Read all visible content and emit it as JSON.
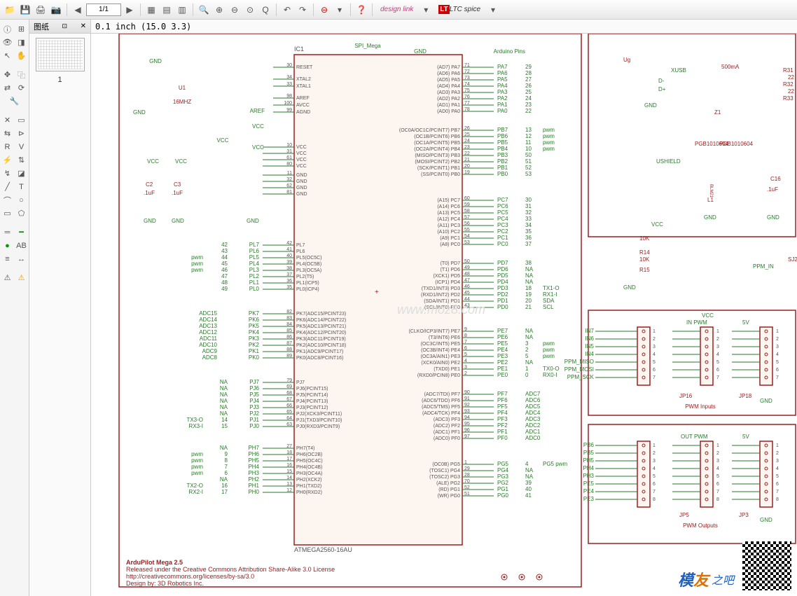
{
  "toolbar": {
    "page_input": "1/1",
    "design_link": "design link",
    "ltc_spice": "LTC spice"
  },
  "thumb": {
    "title": "图纸",
    "page_num": "1"
  },
  "coord": "0.1  inch  (15.0  3.3)",
  "chip": {
    "ref": "IC1",
    "name": "ATMEGA2560-16AU",
    "header_net": "SPI_Mega",
    "header_gnd": "GND",
    "arduino_pins": "Arduino Pins",
    "left_top": [
      {
        "num": "30",
        "name": "RESET"
      },
      {
        "num": "34",
        "name": "XTAL2"
      },
      {
        "num": "33",
        "name": "XTAL1"
      },
      {
        "num": "98",
        "name": "AREF"
      },
      {
        "num": "100",
        "name": "AVCC"
      },
      {
        "num": "99",
        "name": "AGND"
      }
    ],
    "vcc_pins": [
      {
        "num": "10",
        "name": "VCC"
      },
      {
        "num": "31",
        "name": "VCC"
      },
      {
        "num": "61",
        "name": "VCC"
      },
      {
        "num": "80",
        "name": "VCC"
      }
    ],
    "gnd_pins": [
      {
        "num": "11",
        "name": "GND"
      },
      {
        "num": "32",
        "name": "GND"
      },
      {
        "num": "62",
        "name": "GND"
      },
      {
        "num": "81",
        "name": "GND"
      }
    ],
    "pl": [
      {
        "ard": "42",
        "net": "PL7",
        "num": "42",
        "name": "PL7"
      },
      {
        "ard": "43",
        "net": "PL6",
        "num": "41",
        "name": "PL6"
      },
      {
        "ard": "44",
        "net": "PL5",
        "num": "40",
        "name": "PL5(OC5C)",
        "suf": "pwm"
      },
      {
        "ard": "45",
        "net": "PL4",
        "num": "39",
        "name": "PL4(OC5B)",
        "suf": "pwm"
      },
      {
        "ard": "46",
        "net": "PL3",
        "num": "38",
        "name": "PL3(OC5A)",
        "suf": "pwm"
      },
      {
        "ard": "47",
        "net": "PL2",
        "num": "37",
        "name": "PL2(T5)"
      },
      {
        "ard": "48",
        "net": "PL1",
        "num": "36",
        "name": "PL1(ICP5)"
      },
      {
        "ard": "49",
        "net": "PL0",
        "num": "35",
        "name": "PL0(ICP4)"
      }
    ],
    "pk": [
      {
        "net": "PK7",
        "num": "82",
        "name": "PK7(ADC15/PCINT23)",
        "adc": "ADC15"
      },
      {
        "net": "PK6",
        "num": "83",
        "name": "PK6(ADC14/PCINT22)",
        "adc": "ADC14"
      },
      {
        "net": "PK5",
        "num": "84",
        "name": "PK5(ADC13/PCINT21)",
        "adc": "ADC13"
      },
      {
        "net": "PK4",
        "num": "85",
        "name": "PK4(ADC12/PCINT20)",
        "adc": "ADC12"
      },
      {
        "net": "PK3",
        "num": "86",
        "name": "PK3(ADC11/PCINT19)",
        "adc": "ADC11"
      },
      {
        "net": "PK2",
        "num": "87",
        "name": "PK2(ADC10/PCINT18)",
        "adc": "ADC10"
      },
      {
        "net": "PK1",
        "num": "88",
        "name": "PK1(ADC9/PCINT17)",
        "adc": "ADC9"
      },
      {
        "net": "PK0",
        "num": "89",
        "name": "PK0(ADC8/PCINT16)",
        "adc": "ADC8"
      }
    ],
    "pj": [
      {
        "net": "PJ7",
        "num": "79",
        "name": "PJ7",
        "ard": "NA"
      },
      {
        "net": "PJ6",
        "num": "69",
        "name": "PJ6(PCINT15)",
        "ard": "NA"
      },
      {
        "net": "PJ5",
        "num": "68",
        "name": "PJ5(PCINT14)",
        "ard": "NA"
      },
      {
        "net": "PJ4",
        "num": "67",
        "name": "PJ4(PCINT13)",
        "ard": "NA"
      },
      {
        "net": "PJ3",
        "num": "66",
        "name": "PJ3(PCINT12)",
        "ard": "NA"
      },
      {
        "net": "PJ2",
        "num": "65",
        "name": "PJ2(XCK3/PCINT11)",
        "ard": "NA"
      },
      {
        "net": "PJ1",
        "num": "64",
        "name": "PJ1(TXD3/PCINT10)",
        "ard": "14",
        "suf": "TX3-O"
      },
      {
        "net": "PJ0",
        "num": "63",
        "name": "PJ0(RXD3/PCINT9)",
        "ard": "15",
        "suf": "RX3-I"
      }
    ],
    "ph": [
      {
        "net": "PH7",
        "num": "27",
        "name": "PH7(T4)",
        "ard": "NA"
      },
      {
        "net": "PH6",
        "num": "18",
        "name": "PH6(OC2B)",
        "ard": "9",
        "suf": "pwm"
      },
      {
        "net": "PH5",
        "num": "17",
        "name": "PH5(OC4C)",
        "ard": "8",
        "suf": "pwm"
      },
      {
        "net": "PH4",
        "num": "16",
        "name": "PH4(OC4B)",
        "ard": "7",
        "suf": "pwm"
      },
      {
        "net": "PH3",
        "num": "15",
        "name": "PH3(OC4A)",
        "ard": "6",
        "suf": "pwm"
      },
      {
        "net": "PH2",
        "num": "14",
        "name": "PH2(XCK2)",
        "ard": "NA"
      },
      {
        "net": "PH1",
        "num": "13",
        "name": "PH1(TXD2)",
        "ard": "16",
        "suf": "TX2-O"
      },
      {
        "net": "PH0",
        "num": "12",
        "name": "PH0(RXD2)",
        "ard": "17",
        "suf": "RX2-I"
      }
    ],
    "pa": [
      {
        "name": "(AD7) PA7",
        "num": "71",
        "net": "PA7",
        "ard": "29"
      },
      {
        "name": "(AD6) PA6",
        "num": "72",
        "net": "PA6",
        "ard": "28"
      },
      {
        "name": "(AD5) PA5",
        "num": "73",
        "net": "PA5",
        "ard": "27"
      },
      {
        "name": "(AD4) PA4",
        "num": "74",
        "net": "PA4",
        "ard": "26"
      },
      {
        "name": "(AD3) PA3",
        "num": "75",
        "net": "PA3",
        "ard": "25"
      },
      {
        "name": "(AD2) PA2",
        "num": "76",
        "net": "PA2",
        "ard": "24"
      },
      {
        "name": "(AD1) PA1",
        "num": "77",
        "net": "PA1",
        "ard": "23"
      },
      {
        "name": "(AD0) PA0",
        "num": "78",
        "net": "PA0",
        "ard": "22"
      }
    ],
    "pb": [
      {
        "name": "(OC0A/OC1C/PCINT7) PB7",
        "num": "26",
        "net": "PB7",
        "ard": "13",
        "suf": "pwm"
      },
      {
        "name": "(OC1B/PCINT6) PB6",
        "num": "25",
        "net": "PB6",
        "ard": "12",
        "suf": "pwm"
      },
      {
        "name": "(OC1A/PCINT5) PB5",
        "num": "24",
        "net": "PB5",
        "ard": "11",
        "suf": "pwm"
      },
      {
        "name": "(OC2A/PCINT4) PB4",
        "num": "23",
        "net": "PB4",
        "ard": "10",
        "suf": "pwm"
      },
      {
        "name": "(MISO/PCINT3) PB3",
        "num": "22",
        "net": "PB3",
        "ard": "50"
      },
      {
        "name": "(MOSI/PCINT2) PB2",
        "num": "21",
        "net": "PB2",
        "ard": "51"
      },
      {
        "name": "(SCK/PCINT1) PB1",
        "num": "20",
        "net": "PB1",
        "ard": "52"
      },
      {
        "name": "(SS/PCINT0) PB0",
        "num": "19",
        "net": "PB0",
        "ard": "53"
      }
    ],
    "pc": [
      {
        "name": "(A15) PC7",
        "num": "60",
        "net": "PC7",
        "ard": "30"
      },
      {
        "name": "(A14) PC6",
        "num": "59",
        "net": "PC6",
        "ard": "31"
      },
      {
        "name": "(A13) PC5",
        "num": "58",
        "net": "PC5",
        "ard": "32"
      },
      {
        "name": "(A12) PC4",
        "num": "57",
        "net": "PC4",
        "ard": "33"
      },
      {
        "name": "(A11) PC3",
        "num": "56",
        "net": "PC3",
        "ard": "34"
      },
      {
        "name": "(A10) PC2",
        "num": "55",
        "net": "PC2",
        "ard": "35"
      },
      {
        "name": "(A9) PC1",
        "num": "54",
        "net": "PC1",
        "ard": "36"
      },
      {
        "name": "(A8) PC0",
        "num": "53",
        "net": "PC0",
        "ard": "37"
      }
    ],
    "pd": [
      {
        "name": "(T0) PD7",
        "num": "50",
        "net": "PD7",
        "ard": "38"
      },
      {
        "name": "(T1) PD6",
        "num": "49",
        "net": "PD6",
        "ard": "NA"
      },
      {
        "name": "(XCK1) PD5",
        "num": "48",
        "net": "PD5",
        "ard": "NA"
      },
      {
        "name": "(ICP1) PD4",
        "num": "47",
        "net": "PD4",
        "ard": "NA"
      },
      {
        "name": "(TXD1/INT3) PD3",
        "num": "46",
        "net": "PD3",
        "ard": "18",
        "suf": "TX1-O"
      },
      {
        "name": "(RXD1/INT2) PD2",
        "num": "45",
        "net": "PD2",
        "ard": "19",
        "suf": "RX1-I"
      },
      {
        "name": "(SDA/INT1) PD1",
        "num": "44",
        "net": "PD1",
        "ard": "20",
        "suf": "SDA"
      },
      {
        "name": "(SCL/INT0) PD0",
        "num": "43",
        "net": "PD0",
        "ard": "21",
        "suf": "SCL"
      }
    ],
    "pe": [
      {
        "name": "(CLKO/ICP3/INT7) PE7",
        "num": "9",
        "net": "PE7",
        "ard": "NA"
      },
      {
        "name": "(T3/INT6) PE6",
        "num": "8",
        "net": "PE6",
        "ard": "NA"
      },
      {
        "name": "(OC3C/INT5) PE5",
        "num": "7",
        "net": "PE5",
        "ard": "3",
        "suf": "pwm"
      },
      {
        "name": "(OC3B/INT4) PE4",
        "num": "6",
        "net": "PE4",
        "ard": "2",
        "suf": "pwm"
      },
      {
        "name": "(OC3A/AIN1) PE3",
        "num": "5",
        "net": "PE3",
        "ard": "5",
        "suf": "pwm"
      },
      {
        "name": "(XCK0/AIN0) PE2",
        "num": "4",
        "net": "PE2",
        "ard": "NA"
      },
      {
        "name": "(TXD0) PE1",
        "num": "3",
        "net": "PE1",
        "ard": "1",
        "suf": "TX0-O"
      },
      {
        "name": "(RXD0/PCIN8) PE0",
        "num": "2",
        "net": "PE0",
        "ard": "0",
        "suf": "RX0-I"
      }
    ],
    "pf": [
      {
        "name": "(ADC7/TDI) PF7",
        "num": "90",
        "net": "PF7",
        "ard": "ADC7"
      },
      {
        "name": "(ADC6/TDO) PF6",
        "num": "91",
        "net": "PF6",
        "ard": "ADC6"
      },
      {
        "name": "(ADC5/TMS) PF5",
        "num": "92",
        "net": "PF5",
        "ard": "ADC5"
      },
      {
        "name": "(ADC4/TCK) PF4",
        "num": "93",
        "net": "PF4",
        "ard": "ADC4"
      },
      {
        "name": "(ADC3) PF3",
        "num": "94",
        "net": "PF3",
        "ard": "ADC3"
      },
      {
        "name": "(ADC2) PF2",
        "num": "95",
        "net": "PF2",
        "ard": "ADC2"
      },
      {
        "name": "(ADC1) PF1",
        "num": "96",
        "net": "PF1",
        "ard": "ADC1"
      },
      {
        "name": "(ADC0) PF0",
        "num": "97",
        "net": "PF0",
        "ard": "ADC0"
      }
    ],
    "pg": [
      {
        "name": "(OC0B) PG5",
        "num": "1",
        "net": "PG5",
        "ard": "4",
        "suf": "PG5 pwm"
      },
      {
        "name": "(TOSC1) PG4",
        "num": "29",
        "net": "PG4",
        "ard": "NA"
      },
      {
        "name": "(TOSC2) PG3",
        "num": "28",
        "net": "PG3",
        "ard": "NA"
      },
      {
        "name": "(ALE) PG2",
        "num": "70",
        "net": "PG2",
        "ard": "39"
      },
      {
        "name": "(RD) PG1",
        "num": "52",
        "net": "PG1",
        "ard": "40"
      },
      {
        "name": "(WR) PG0",
        "num": "51",
        "net": "PG0",
        "ard": "41"
      }
    ]
  },
  "power": {
    "vcc": "VCC",
    "gnd": "GND",
    "aref": "AREF",
    "c2": {
      "ref": "C2",
      "val": ".1uF"
    },
    "c3": {
      "ref": "C3",
      "val": ".1uF"
    },
    "xtal": {
      "ref": "U1",
      "val": "16MHZ"
    }
  },
  "right": {
    "xusb": "XUSB",
    "dp": "D+",
    "dm": "D-",
    "fuse": "500mA",
    "ug": "Ug",
    "gnd": "GND",
    "vcc": "VCC",
    "r31": "R31",
    "r32": "R32",
    "r33": "R33",
    "r14": "R14",
    "r15": "R15",
    "v10k": "10K",
    "z1": "Z1",
    "l1": "L1",
    "blm21": "BLM21",
    "c16": "C16",
    "c1uf": ".1uF",
    "pgb": "PGB1010604",
    "ushield": "USHIELD",
    "ppm_in": "PPM_IN",
    "sj2": "SJ2",
    "r22": "22"
  },
  "pwm_in": {
    "title": "PWM Inputs",
    "in_pwm": "IN PWM",
    "v5": "5V",
    "gnd": "GND",
    "jp16": "JP16",
    "jp18": "JP18",
    "nets": [
      "IN7",
      "IN6",
      "IN5",
      "IN4",
      "PPM_MISO",
      "PPM_MOSI",
      "PPM_SCK"
    ]
  },
  "pwm_out": {
    "title": "PWM Outputs",
    "out_pwm": "OUT PWM",
    "v5": "5V",
    "gnd": "GND",
    "jp5": "JP5",
    "jp3": "JP3",
    "nets": [
      "PB6",
      "PB5",
      "PH5",
      "PH4",
      "PH3",
      "PE5",
      "PE4",
      "PE3"
    ]
  },
  "title_block": {
    "name": "ArduPilot Mega 2.5",
    "lic": "Released under the Creative Commons Attribution Share-Alike 3.0 License",
    "url": "http://creativecommons.org/licenses/by-sa/3.0",
    "design": "Design by:      3D Robotics Inc."
  },
  "watermark": "www.moz8.com",
  "logo": {
    "char1": "模",
    "char2": "友",
    "suffix": "之吧"
  }
}
